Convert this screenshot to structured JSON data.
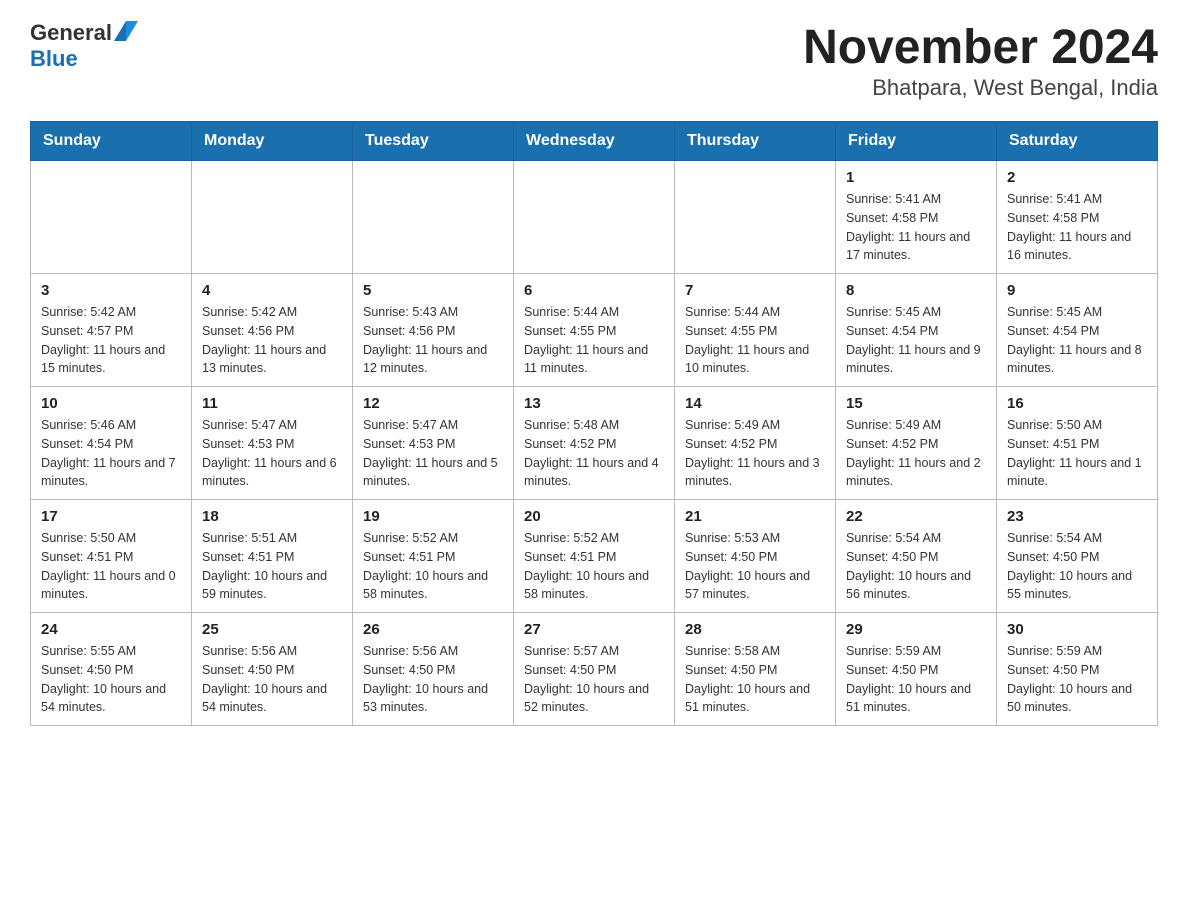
{
  "header": {
    "logo_general": "General",
    "logo_blue": "Blue",
    "title": "November 2024",
    "subtitle": "Bhatpara, West Bengal, India"
  },
  "weekdays": [
    "Sunday",
    "Monday",
    "Tuesday",
    "Wednesday",
    "Thursday",
    "Friday",
    "Saturday"
  ],
  "weeks": [
    [
      {
        "day": "",
        "info": ""
      },
      {
        "day": "",
        "info": ""
      },
      {
        "day": "",
        "info": ""
      },
      {
        "day": "",
        "info": ""
      },
      {
        "day": "",
        "info": ""
      },
      {
        "day": "1",
        "info": "Sunrise: 5:41 AM\nSunset: 4:58 PM\nDaylight: 11 hours and 17 minutes."
      },
      {
        "day": "2",
        "info": "Sunrise: 5:41 AM\nSunset: 4:58 PM\nDaylight: 11 hours and 16 minutes."
      }
    ],
    [
      {
        "day": "3",
        "info": "Sunrise: 5:42 AM\nSunset: 4:57 PM\nDaylight: 11 hours and 15 minutes."
      },
      {
        "day": "4",
        "info": "Sunrise: 5:42 AM\nSunset: 4:56 PM\nDaylight: 11 hours and 13 minutes."
      },
      {
        "day": "5",
        "info": "Sunrise: 5:43 AM\nSunset: 4:56 PM\nDaylight: 11 hours and 12 minutes."
      },
      {
        "day": "6",
        "info": "Sunrise: 5:44 AM\nSunset: 4:55 PM\nDaylight: 11 hours and 11 minutes."
      },
      {
        "day": "7",
        "info": "Sunrise: 5:44 AM\nSunset: 4:55 PM\nDaylight: 11 hours and 10 minutes."
      },
      {
        "day": "8",
        "info": "Sunrise: 5:45 AM\nSunset: 4:54 PM\nDaylight: 11 hours and 9 minutes."
      },
      {
        "day": "9",
        "info": "Sunrise: 5:45 AM\nSunset: 4:54 PM\nDaylight: 11 hours and 8 minutes."
      }
    ],
    [
      {
        "day": "10",
        "info": "Sunrise: 5:46 AM\nSunset: 4:54 PM\nDaylight: 11 hours and 7 minutes."
      },
      {
        "day": "11",
        "info": "Sunrise: 5:47 AM\nSunset: 4:53 PM\nDaylight: 11 hours and 6 minutes."
      },
      {
        "day": "12",
        "info": "Sunrise: 5:47 AM\nSunset: 4:53 PM\nDaylight: 11 hours and 5 minutes."
      },
      {
        "day": "13",
        "info": "Sunrise: 5:48 AM\nSunset: 4:52 PM\nDaylight: 11 hours and 4 minutes."
      },
      {
        "day": "14",
        "info": "Sunrise: 5:49 AM\nSunset: 4:52 PM\nDaylight: 11 hours and 3 minutes."
      },
      {
        "day": "15",
        "info": "Sunrise: 5:49 AM\nSunset: 4:52 PM\nDaylight: 11 hours and 2 minutes."
      },
      {
        "day": "16",
        "info": "Sunrise: 5:50 AM\nSunset: 4:51 PM\nDaylight: 11 hours and 1 minute."
      }
    ],
    [
      {
        "day": "17",
        "info": "Sunrise: 5:50 AM\nSunset: 4:51 PM\nDaylight: 11 hours and 0 minutes."
      },
      {
        "day": "18",
        "info": "Sunrise: 5:51 AM\nSunset: 4:51 PM\nDaylight: 10 hours and 59 minutes."
      },
      {
        "day": "19",
        "info": "Sunrise: 5:52 AM\nSunset: 4:51 PM\nDaylight: 10 hours and 58 minutes."
      },
      {
        "day": "20",
        "info": "Sunrise: 5:52 AM\nSunset: 4:51 PM\nDaylight: 10 hours and 58 minutes."
      },
      {
        "day": "21",
        "info": "Sunrise: 5:53 AM\nSunset: 4:50 PM\nDaylight: 10 hours and 57 minutes."
      },
      {
        "day": "22",
        "info": "Sunrise: 5:54 AM\nSunset: 4:50 PM\nDaylight: 10 hours and 56 minutes."
      },
      {
        "day": "23",
        "info": "Sunrise: 5:54 AM\nSunset: 4:50 PM\nDaylight: 10 hours and 55 minutes."
      }
    ],
    [
      {
        "day": "24",
        "info": "Sunrise: 5:55 AM\nSunset: 4:50 PM\nDaylight: 10 hours and 54 minutes."
      },
      {
        "day": "25",
        "info": "Sunrise: 5:56 AM\nSunset: 4:50 PM\nDaylight: 10 hours and 54 minutes."
      },
      {
        "day": "26",
        "info": "Sunrise: 5:56 AM\nSunset: 4:50 PM\nDaylight: 10 hours and 53 minutes."
      },
      {
        "day": "27",
        "info": "Sunrise: 5:57 AM\nSunset: 4:50 PM\nDaylight: 10 hours and 52 minutes."
      },
      {
        "day": "28",
        "info": "Sunrise: 5:58 AM\nSunset: 4:50 PM\nDaylight: 10 hours and 51 minutes."
      },
      {
        "day": "29",
        "info": "Sunrise: 5:59 AM\nSunset: 4:50 PM\nDaylight: 10 hours and 51 minutes."
      },
      {
        "day": "30",
        "info": "Sunrise: 5:59 AM\nSunset: 4:50 PM\nDaylight: 10 hours and 50 minutes."
      }
    ]
  ]
}
